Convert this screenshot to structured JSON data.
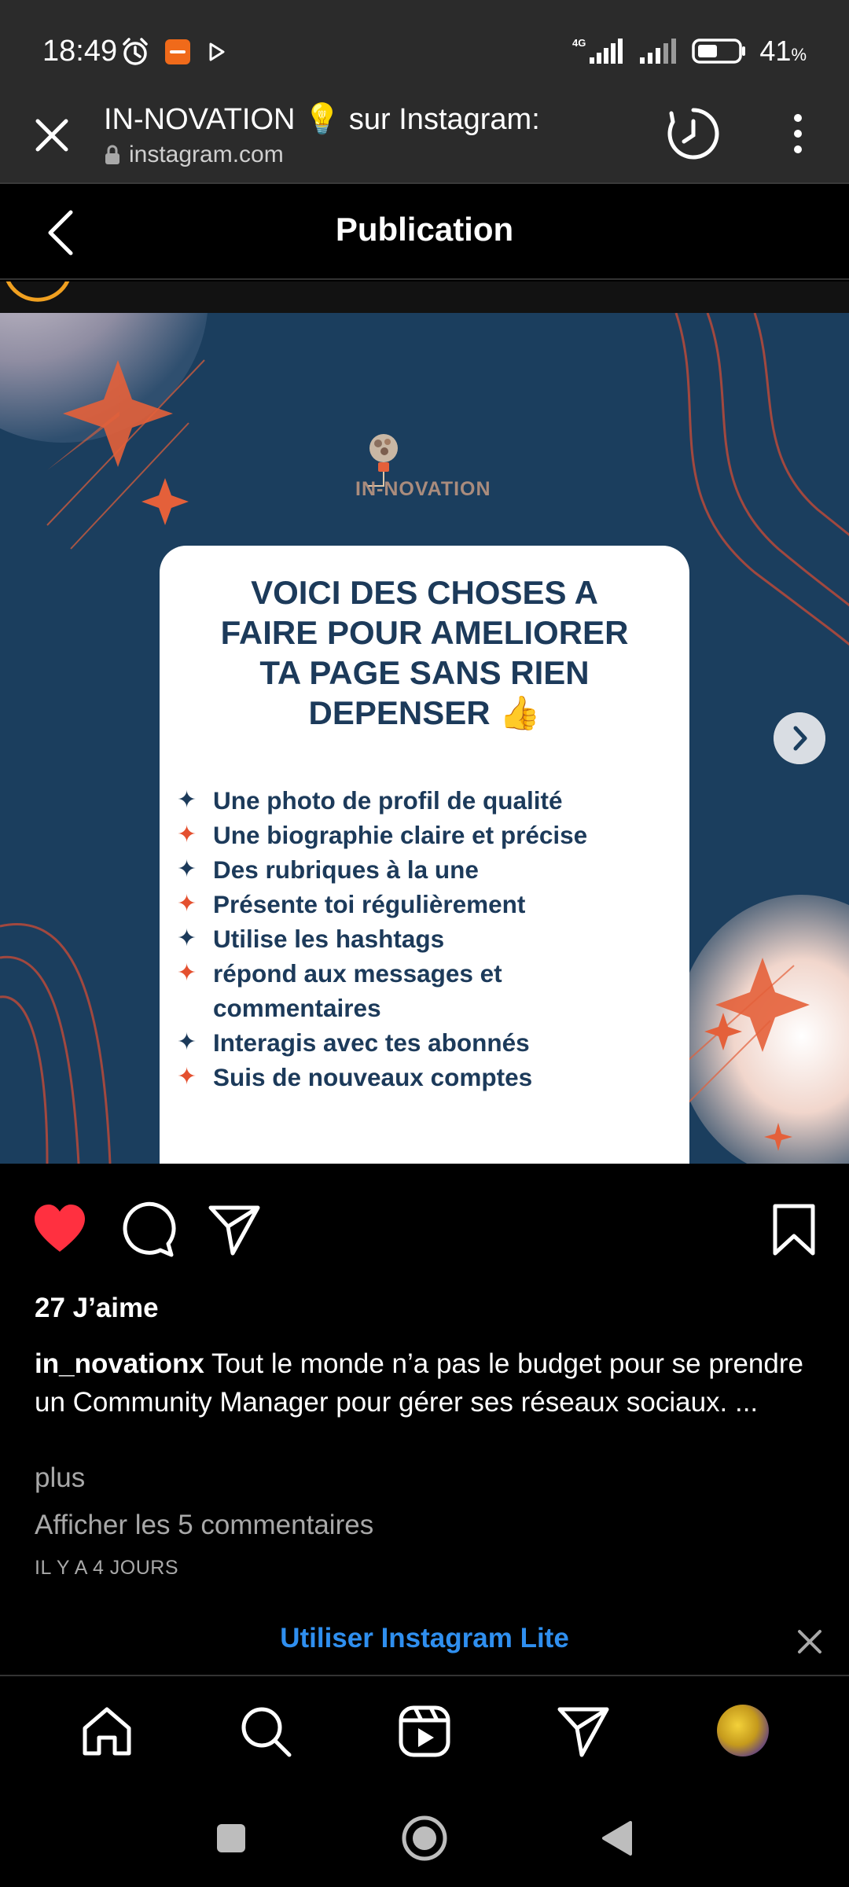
{
  "status_bar": {
    "time": "18:49",
    "network": "4G",
    "battery": "41",
    "battery_unit": "%"
  },
  "browser": {
    "title": "IN-NOVATION 💡 sur Instagram:",
    "url": "instagram.com"
  },
  "header": {
    "title": "Publication"
  },
  "post": {
    "brand": "IN-NOVATION",
    "card_title_lines": [
      "VOICI DES CHOSES A",
      "FAIRE POUR AMELIORER",
      "TA PAGE SANS RIEN",
      "DEPENSER 👍"
    ],
    "list": [
      {
        "text": "Une photo de profil de qualité",
        "star": "dark"
      },
      {
        "text": "Une biographie claire et précise",
        "star": "red"
      },
      {
        "text": "Des rubriques à la une",
        "star": "dark"
      },
      {
        "text": "Présente toi régulièrement",
        "star": "red"
      },
      {
        "text": "Utilise les hashtags",
        "star": "dark"
      },
      {
        "text": "répond aux messages et commentaires",
        "star": "red"
      },
      {
        "text": "Interagis avec tes abonnés",
        "star": "dark"
      },
      {
        "text": "Suis de nouveaux comptes",
        "star": "red"
      }
    ],
    "likes": "27 J’aime",
    "caption_user": "in_novationx",
    "caption_text": " Tout le monde n’a pas le budget pour se prendre un Community Manager pour gérer ses réseaux sociaux. ...",
    "more": "plus",
    "comments_link": "Afficher les 5 commentaires",
    "time_ago": "IL Y A 4 JOURS"
  },
  "lite_banner": {
    "label": "Utiliser Instagram Lite"
  },
  "colors": {
    "like_red": "#ff3040",
    "accent_blue": "#2f8fef",
    "post_bg": "#1b3e5e",
    "card_text": "#1c3a5a",
    "star_red": "#e4502f"
  },
  "icons": {
    "close": "close-icon",
    "history": "history-icon",
    "menu": "more-vert-icon",
    "back": "chevron-left-icon",
    "like": "heart-filled-icon",
    "comment": "comment-icon",
    "share": "send-icon",
    "save": "bookmark-icon",
    "home": "home-icon",
    "search": "search-icon",
    "reels": "reels-icon",
    "direct": "send-icon"
  }
}
